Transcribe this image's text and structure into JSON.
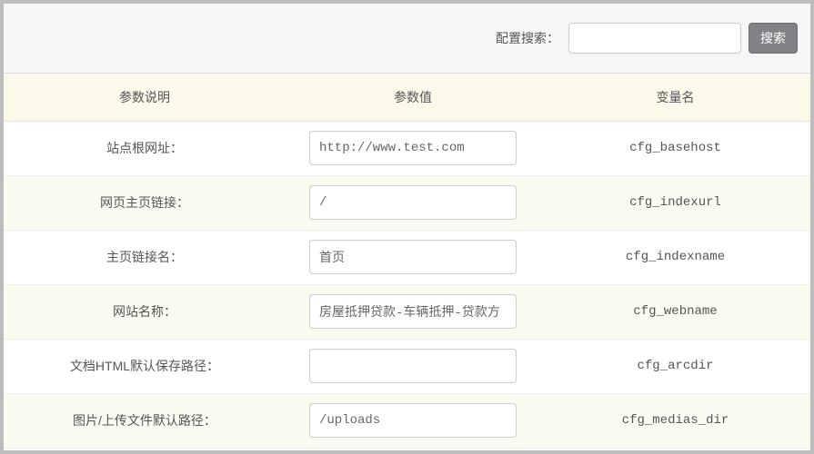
{
  "search": {
    "label": "配置搜索：",
    "value": "",
    "button": "搜索"
  },
  "table": {
    "headers": [
      "参数说明",
      "参数值",
      "变量名"
    ],
    "rows": [
      {
        "desc": "站点根网址：",
        "value": "http://www.test.com",
        "var": "cfg_basehost"
      },
      {
        "desc": "网页主页链接：",
        "value": "/",
        "var": "cfg_indexurl"
      },
      {
        "desc": "主页链接名：",
        "value": "首页",
        "var": "cfg_indexname"
      },
      {
        "desc": "网站名称：",
        "value": "房屋抵押贷款-车辆抵押-贷款方",
        "var": "cfg_webname"
      },
      {
        "desc": "文档HTML默认保存路径：",
        "value": "",
        "var": "cfg_arcdir"
      },
      {
        "desc": "图片/上传文件默认路径：",
        "value": "/uploads",
        "var": "cfg_medias_dir"
      }
    ]
  }
}
